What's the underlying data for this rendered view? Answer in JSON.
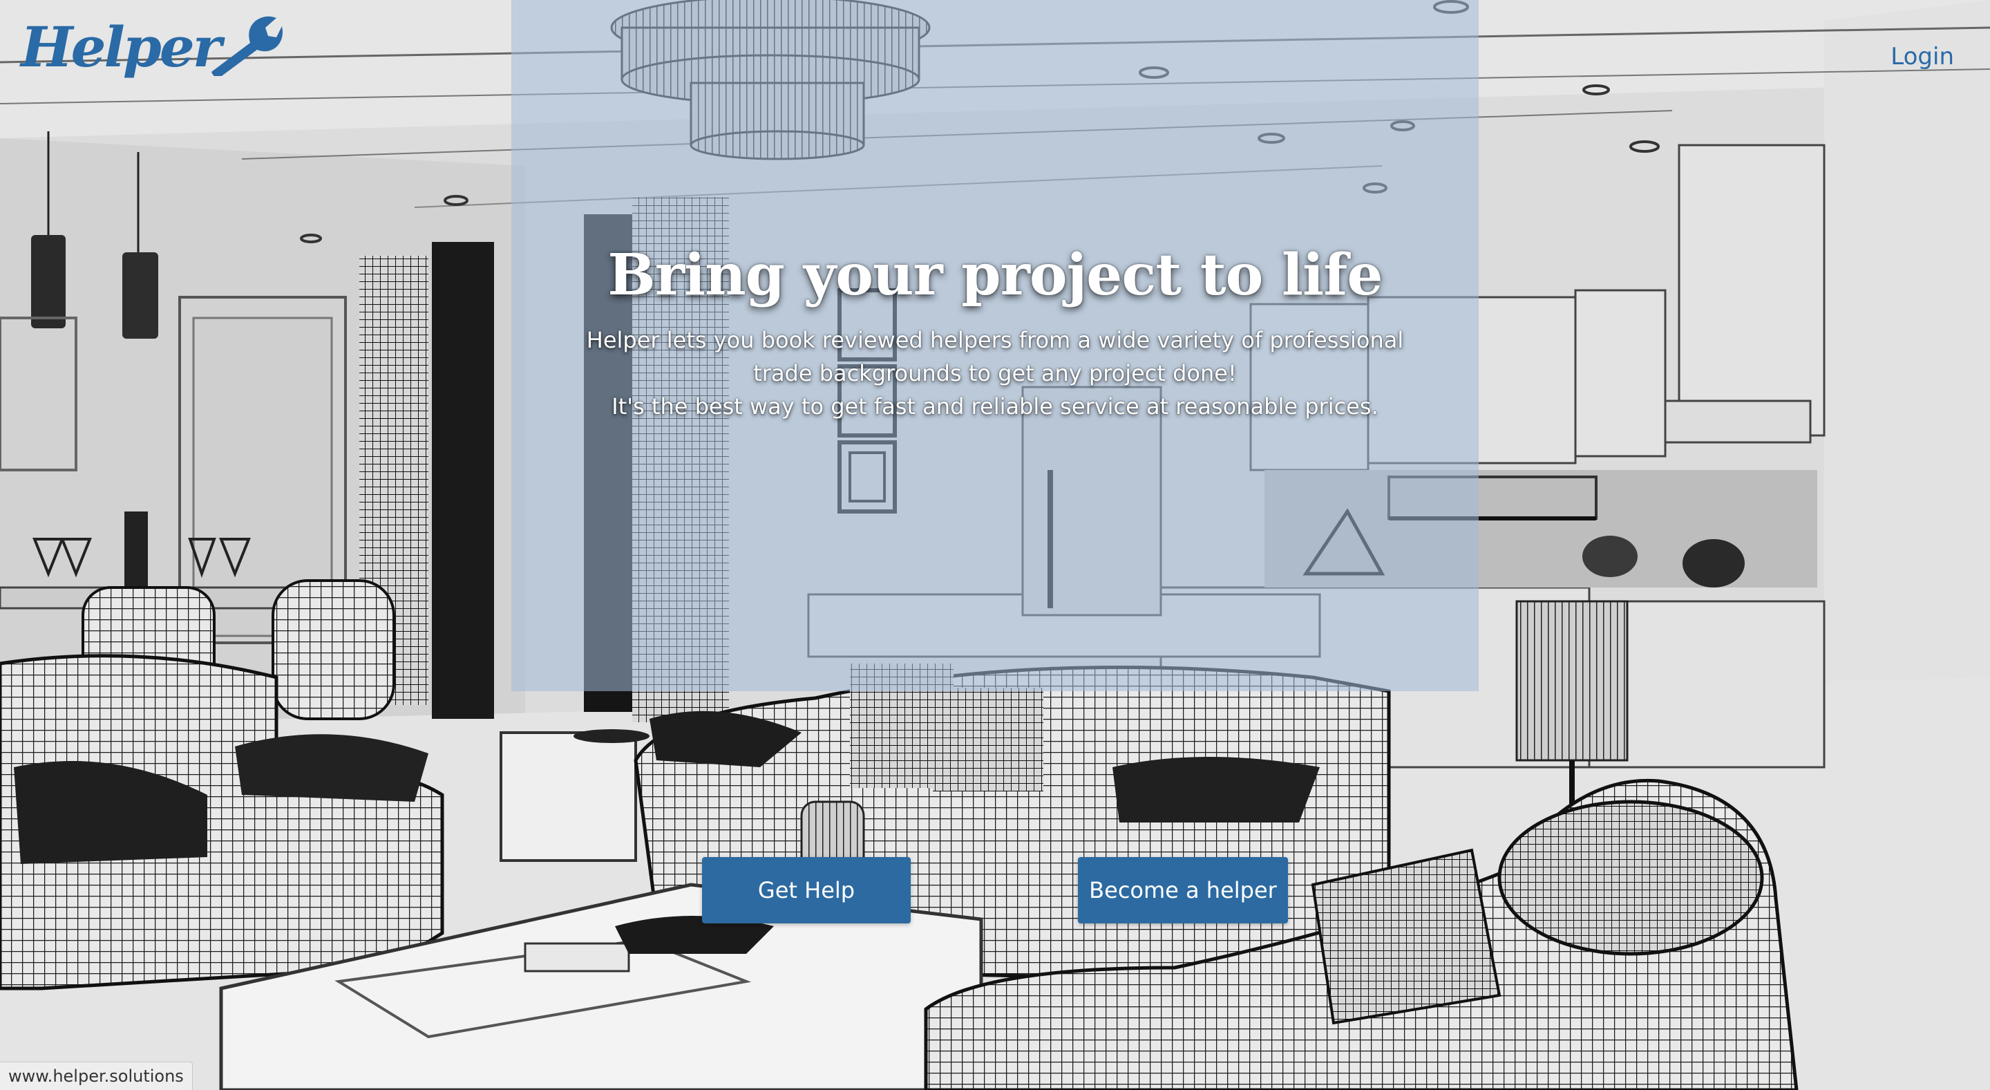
{
  "header": {
    "logo_text": "Helper",
    "login_label": "Login"
  },
  "hero": {
    "headline": "Bring your project to life",
    "subtext_line1": "Helper lets you book reviewed helpers from a wide variety of professional trade backgrounds to get any project done!",
    "subtext_line2": "It's the best way to get fast and reliable service at reasonable prices."
  },
  "actions": {
    "get_help_label": "Get Help",
    "become_helper_label": "Become a helper"
  },
  "status_bar": {
    "url": "www.helper.solutions"
  },
  "colors": {
    "brand": "#2a6aa6",
    "button": "#2c6aa1",
    "overlay": "#a0b9d7"
  },
  "icons": {
    "logo": "wrench-icon"
  }
}
